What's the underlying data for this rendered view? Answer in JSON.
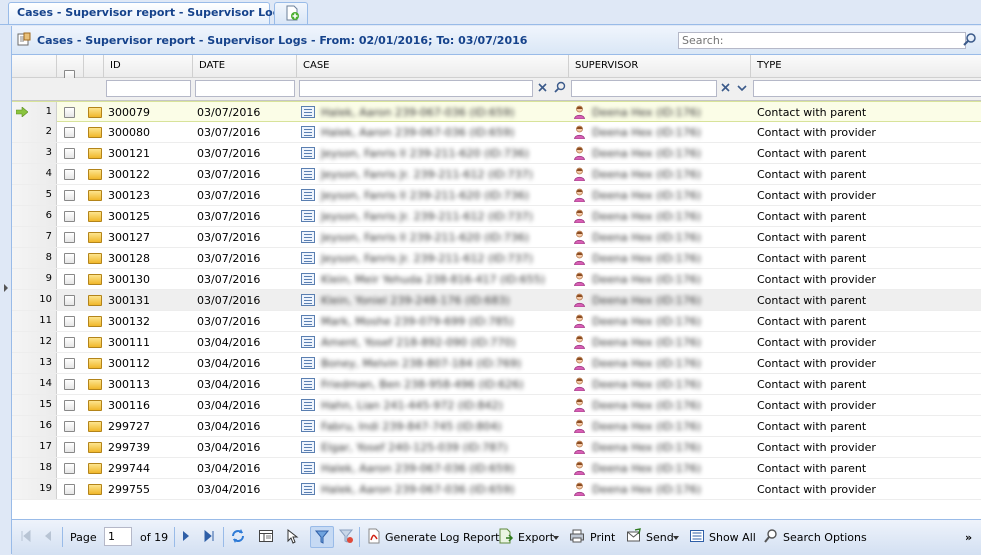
{
  "tabs": {
    "main_label": "Cases - Supervisor report - Supervisor Logs"
  },
  "panel": {
    "title": "Cases - Supervisor report - Supervisor Logs - From: 02/01/2016; To: 03/07/2016"
  },
  "search": {
    "placeholder": "Search:"
  },
  "columns": {
    "id": "ID",
    "date": "DATE",
    "case": "CASE",
    "supervisor": "SUPERVISOR",
    "type": "TYPE"
  },
  "rows": [
    {
      "num": "1",
      "id": "300079",
      "date": "03/07/2016",
      "case": "Halek, Aaron 239-067-036 (ID:659)",
      "supervisor": "Deena Hex (ID:176)",
      "type": "Contact with parent"
    },
    {
      "num": "2",
      "id": "300080",
      "date": "03/07/2016",
      "case": "Halek, Aaron 239-067-036 (ID:659)",
      "supervisor": "Deena Hex (ID:176)",
      "type": "Contact with provider"
    },
    {
      "num": "3",
      "id": "300121",
      "date": "03/07/2016",
      "case": "Jeyson, Fanris Il 239-211-620 (ID:736)",
      "supervisor": "Deena Hex (ID:176)",
      "type": "Contact with parent"
    },
    {
      "num": "4",
      "id": "300122",
      "date": "03/07/2016",
      "case": "Jeyson, Fanris Jr. 239-211-612 (ID:737)",
      "supervisor": "Deena Hex (ID:176)",
      "type": "Contact with parent"
    },
    {
      "num": "5",
      "id": "300123",
      "date": "03/07/2016",
      "case": "Jeyson, Fanris Il 239-211-620 (ID:736)",
      "supervisor": "Deena Hex (ID:176)",
      "type": "Contact with provider"
    },
    {
      "num": "6",
      "id": "300125",
      "date": "03/07/2016",
      "case": "Jeyson, Fanris Jr. 239-211-612 (ID:737)",
      "supervisor": "Deena Hex (ID:176)",
      "type": "Contact with parent"
    },
    {
      "num": "7",
      "id": "300127",
      "date": "03/07/2016",
      "case": "Jeyson, Fanris Il 239-211-620 (ID:736)",
      "supervisor": "Deena Hex (ID:176)",
      "type": "Contact with parent"
    },
    {
      "num": "8",
      "id": "300128",
      "date": "03/07/2016",
      "case": "Jeyson, Fanris Jr. 239-211-612 (ID:737)",
      "supervisor": "Deena Hex (ID:176)",
      "type": "Contact with parent"
    },
    {
      "num": "9",
      "id": "300130",
      "date": "03/07/2016",
      "case": "Klein, Meir Yehuda 238-816-417 (ID:655)",
      "supervisor": "Deena Hex (ID:176)",
      "type": "Contact with provider"
    },
    {
      "num": "10",
      "id": "300131",
      "date": "03/07/2016",
      "case": "Klein, Yoniel 239-248-176 (ID:683)",
      "supervisor": "Deena Hex (ID:176)",
      "type": "Contact with parent"
    },
    {
      "num": "11",
      "id": "300132",
      "date": "03/07/2016",
      "case": "Mark, Moshe 239-079-699 (ID:785)",
      "supervisor": "Deena Hex (ID:176)",
      "type": "Contact with parent"
    },
    {
      "num": "12",
      "id": "300111",
      "date": "03/04/2016",
      "case": "Ament, Yosef 218-892-090 (ID:770)",
      "supervisor": "Deena Hex (ID:176)",
      "type": "Contact with provider"
    },
    {
      "num": "13",
      "id": "300112",
      "date": "03/04/2016",
      "case": "Boney, Melvin 238-807-184 (ID:769)",
      "supervisor": "Deena Hex (ID:176)",
      "type": "Contact with provider"
    },
    {
      "num": "14",
      "id": "300113",
      "date": "03/04/2016",
      "case": "Friedman, Ben 238-958-496 (ID:626)",
      "supervisor": "Deena Hex (ID:176)",
      "type": "Contact with parent"
    },
    {
      "num": "15",
      "id": "300116",
      "date": "03/04/2016",
      "case": "Hahn, Lian 241-445-972 (ID:842)",
      "supervisor": "Deena Hex (ID:176)",
      "type": "Contact with provider"
    },
    {
      "num": "16",
      "id": "299727",
      "date": "03/04/2016",
      "case": "Fabru, Indi 239-847-745 (ID:804)",
      "supervisor": "Deena Hex (ID:176)",
      "type": "Contact with parent"
    },
    {
      "num": "17",
      "id": "299739",
      "date": "03/04/2016",
      "case": "Elgar, Yosef 240-125-039 (ID:787)",
      "supervisor": "Deena Hex (ID:176)",
      "type": "Contact with provider"
    },
    {
      "num": "18",
      "id": "299744",
      "date": "03/04/2016",
      "case": "Halek, Aaron 239-067-036 (ID:659)",
      "supervisor": "Deena Hex (ID:176)",
      "type": "Contact with parent"
    },
    {
      "num": "19",
      "id": "299755",
      "date": "03/04/2016",
      "case": "Halek, Aaron 239-067-036 (ID:659)",
      "supervisor": "Deena Hex (ID:176)",
      "type": "Contact with provider"
    }
  ],
  "pager": {
    "page_label": "Page",
    "page_value": "1",
    "of_label": "of 19"
  },
  "toolbar": {
    "generate": "Generate Log Report",
    "export": "Export",
    "print": "Print",
    "send": "Send",
    "show_all": "Show All",
    "search_options": "Search Options",
    "more": "»"
  },
  "colors": {
    "accent": "#15428b",
    "border": "#99bbe8",
    "selected_row": "#fbfde7"
  }
}
